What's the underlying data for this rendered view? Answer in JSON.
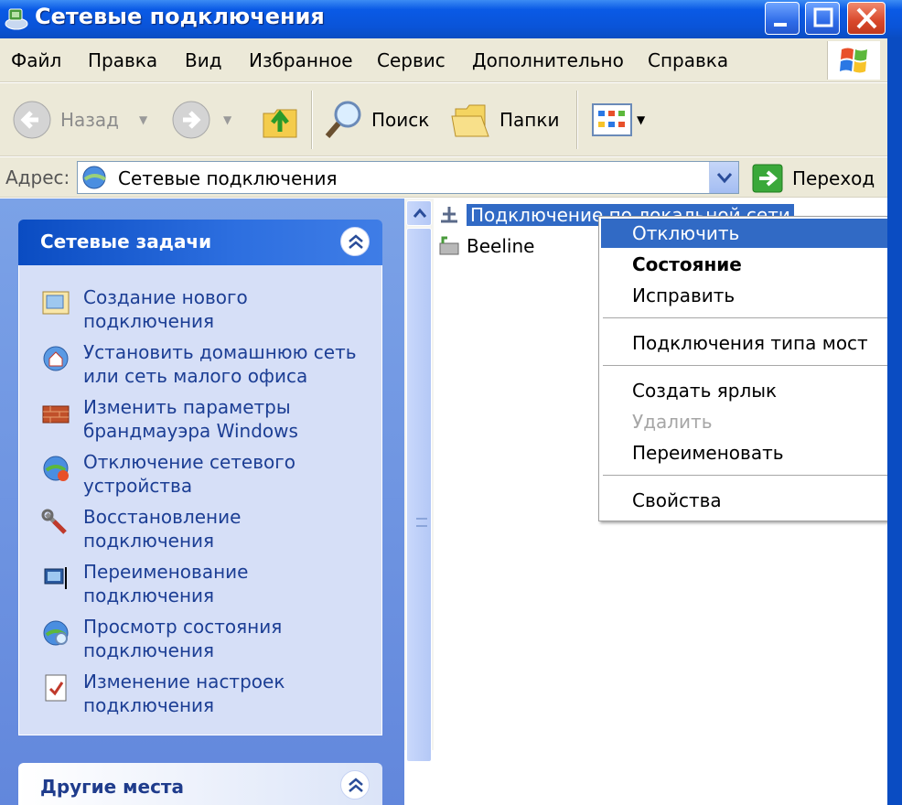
{
  "window": {
    "title": "Сетевые подключения"
  },
  "menu": {
    "items": [
      "Файл",
      "Правка",
      "Вид",
      "Избранное",
      "Сервис",
      "Дополнительно",
      "Справка"
    ]
  },
  "toolbar": {
    "back_label": "Назад",
    "search_label": "Поиск",
    "folders_label": "Папки"
  },
  "address": {
    "label": "Адрес:",
    "value": "Сетевые подключения",
    "go_label": "Переход"
  },
  "task_pane": {
    "network_tasks_title": "Сетевые задачи",
    "tasks": [
      {
        "label": "Создание нового подключения",
        "icon": "new-connection-icon"
      },
      {
        "label": "Установить домашнюю сеть или сеть малого офиса",
        "icon": "home-network-icon"
      },
      {
        "label": "Изменить параметры брандмауэра Windows",
        "icon": "firewall-icon"
      },
      {
        "label": "Отключение сетевого устройства",
        "icon": "disable-device-icon"
      },
      {
        "label": "Восстановление подключения",
        "icon": "repair-icon"
      },
      {
        "label": "Переименование подключения",
        "icon": "rename-icon"
      },
      {
        "label": "Просмотр состояния подключения",
        "icon": "status-icon"
      },
      {
        "label": "Изменение настроек подключения",
        "icon": "settings-icon"
      }
    ],
    "other_places_title": "Другие места"
  },
  "files": {
    "items": [
      {
        "label": "Подключение по локальной сети",
        "selected": true
      },
      {
        "label": "Beeline",
        "selected": false
      }
    ]
  },
  "context_menu": {
    "items": [
      {
        "label": "Отключить",
        "state": "highlighted"
      },
      {
        "label": "Состояние",
        "state": "default"
      },
      {
        "label": "Исправить",
        "state": "normal"
      },
      {
        "label": "Подключения типа мост",
        "state": "normal"
      },
      {
        "label": "Создать ярлык",
        "state": "normal"
      },
      {
        "label": "Удалить",
        "state": "disabled"
      },
      {
        "label": "Переименовать",
        "state": "normal"
      },
      {
        "label": "Свойства",
        "state": "normal"
      }
    ]
  },
  "colors": {
    "titlebar": "#0a54d8",
    "task_pane": "#6f95e2",
    "selection": "#316ac5",
    "task_link": "#1c3e94"
  }
}
